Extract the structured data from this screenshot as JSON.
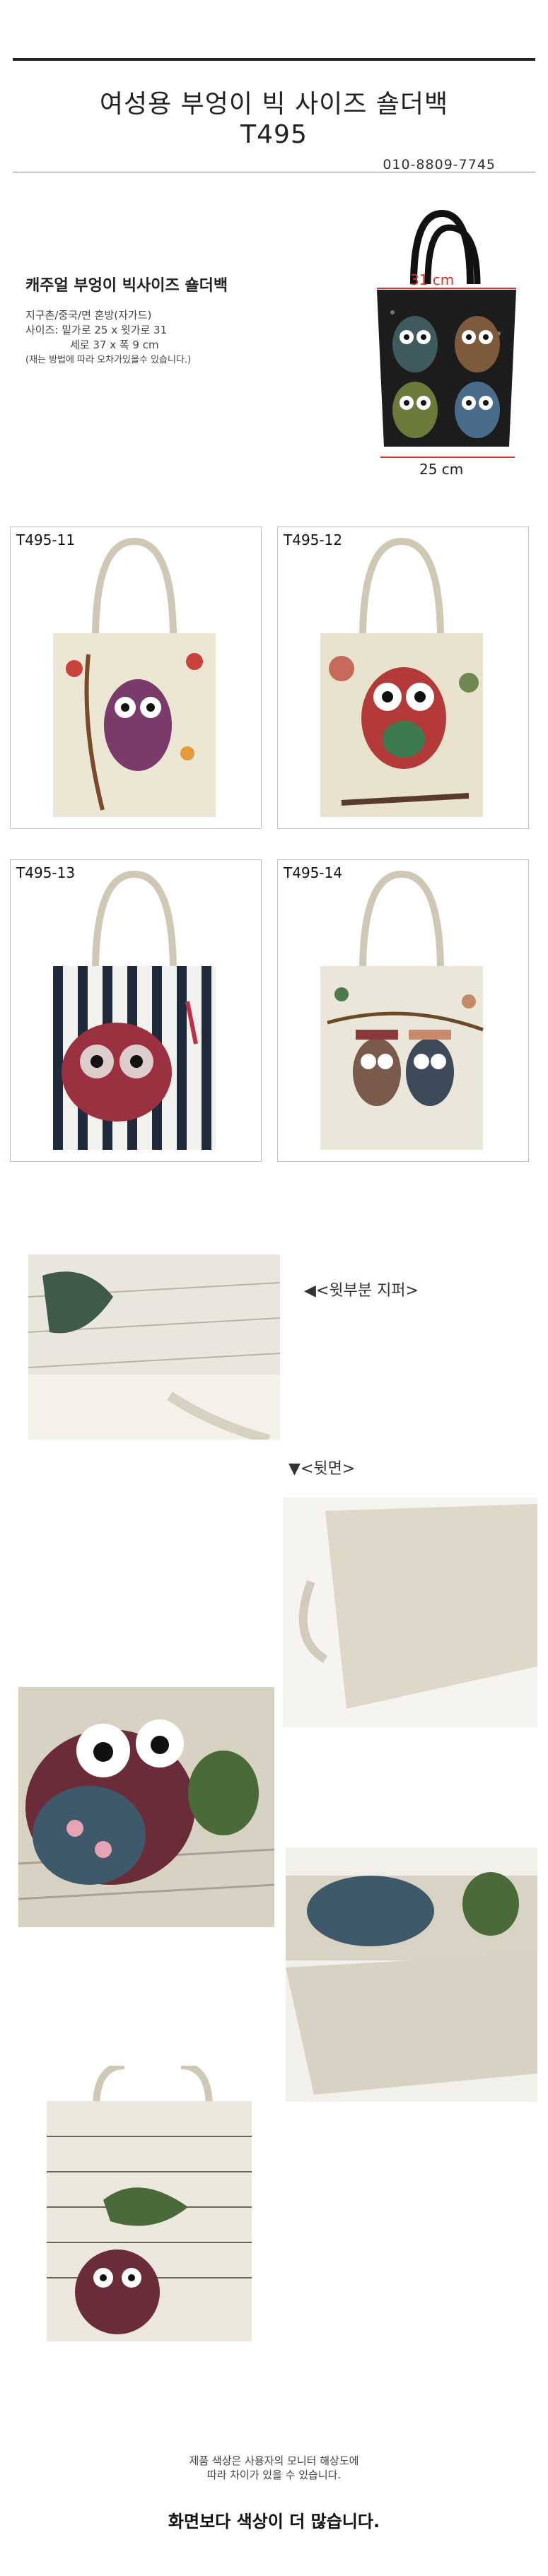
{
  "header": {
    "title_line1": "여성용 부엉이 빅 사이즈 숄더백",
    "title_line2": "T495",
    "phone": "010-8809-7745"
  },
  "info": {
    "heading": "캐주얼 부엉이 빅사이즈 숄더백",
    "line1": "지구촌/중국/면 혼방(자가드)",
    "line2": "사이즈: 밑가로 25 x 윗가로 31",
    "line3": "세로 37 x 폭 9 cm",
    "note": "(재는 방법에 따라 오차가있을수 있습니다.)"
  },
  "dimension": {
    "top_width": "31 cm",
    "bottom_width": "25 cm"
  },
  "variants": [
    {
      "code": "T495-11"
    },
    {
      "code": "T495-12"
    },
    {
      "code": "T495-13"
    },
    {
      "code": "T495-14"
    }
  ],
  "details": {
    "zipper_caption": "◀<윗부분 지퍼>",
    "back_caption": "▼<뒷면>"
  },
  "footer": {
    "note_line1": "제품 색상은 사용자의 모니터 해상도에",
    "note_line2": "따라 차이가 있을 수 있습니다.",
    "final": "화면보다 색상이  더 많습니다."
  },
  "colors": {
    "accent_red": "#d9342b",
    "text": "#333333",
    "rule": "#222222"
  }
}
